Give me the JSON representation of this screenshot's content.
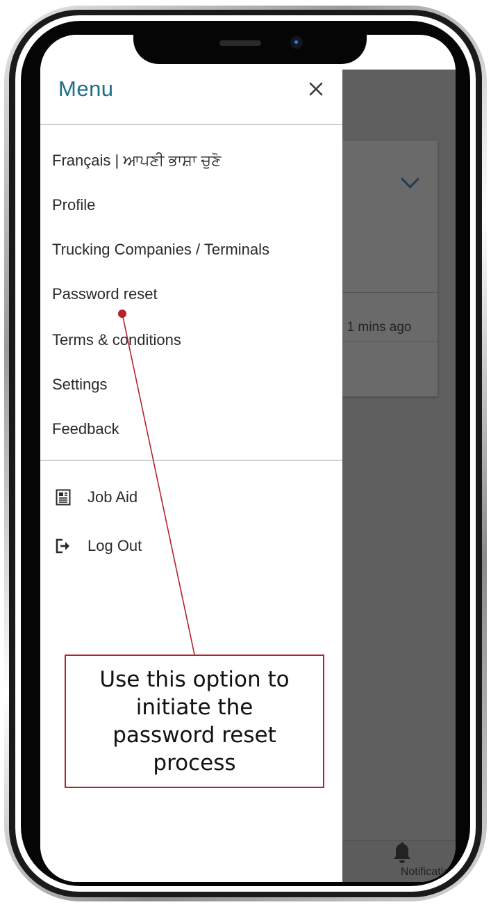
{
  "drawer": {
    "title": "Menu",
    "items": [
      {
        "label": "Français | ਆਪਣੀ ਭਾਸ਼ਾ ਚੁਣੋ"
      },
      {
        "label": "Profile"
      },
      {
        "label": "Trucking Companies / Terminals"
      },
      {
        "label": "Password reset"
      },
      {
        "label": "Terms & conditions"
      },
      {
        "label": "Settings"
      },
      {
        "label": "Feedback"
      }
    ],
    "secondary_items": [
      {
        "label": "Job Aid",
        "icon": "document-icon"
      },
      {
        "label": "Log Out",
        "icon": "logout-icon"
      }
    ]
  },
  "background_app": {
    "time_ago": ": 1 mins ago",
    "bottom_nav": {
      "notification_label": "Notification",
      "icon": "bell-icon"
    }
  },
  "callout": {
    "text": "Use this option to initiate the password reset process",
    "color": "#b3232d"
  },
  "colors": {
    "menu_title": "#1a6f8a",
    "overlay": "#5f5f5f"
  }
}
